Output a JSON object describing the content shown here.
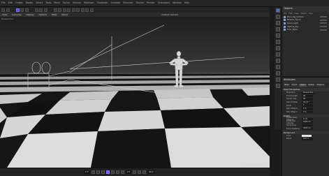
{
  "menubar": {
    "items": [
      "File",
      "Edit",
      "Create",
      "Modes",
      "Select",
      "Tools",
      "Mesh",
      "Spline",
      "Volume",
      "MoGraph",
      "Character",
      "Animate",
      "Simulate",
      "Tracker",
      "Render",
      "Extensions",
      "Window",
      "Help"
    ]
  },
  "viewport": {
    "tabs": [
      "View",
      "Cameras",
      "Display",
      "Options",
      "Filter",
      "Panel"
    ],
    "camera_label": "Default Camera",
    "label": "Perspective",
    "stats": "Grid Spacing : 100 cm"
  },
  "timeline": {
    "start_frame": "0 F",
    "end_frame": "90 F",
    "current_frame": "0 F"
  },
  "objects_panel": {
    "title": "Objects",
    "menu": [
      "File",
      "Edit",
      "View",
      "Object",
      "Tags"
    ],
    "objects": [
      "Bone_Rig_Camera",
      "Mixamo_Figure",
      "Scene_Light",
      "Capture_Rig",
      "Floor_Plane"
    ]
  },
  "attributes_panel": {
    "title": "Attributes",
    "tabs": [
      "Basic",
      "Coord.",
      "Object",
      "Details",
      "Physical"
    ],
    "section_object": "Object Properties",
    "fields": [
      {
        "label": "Projection",
        "value": "Perspective"
      },
      {
        "label": "Focal Length",
        "value": "36"
      },
      {
        "label": "Sensor Size",
        "value": "36"
      },
      {
        "label": "Field of View",
        "value": "53.13 °"
      },
      {
        "label": "Zoom",
        "value": "1"
      },
      {
        "label": "Film Offset X",
        "value": "0 %"
      },
      {
        "label": "Film Offset Y",
        "value": "0 %"
      }
    ],
    "section_details": "Details",
    "details": [
      {
        "label": "Enable Near Clipping",
        "value": "0 cm"
      },
      {
        "label": "Enable Far Clipping",
        "value": "1000 cm"
      },
      {
        "label": "Show Cone",
        "value": ""
      },
      {
        "label": "Focus Distance",
        "value": "2000 cm"
      }
    ],
    "section_background": "Background",
    "bg_color_label": "Color",
    "bg_blend_label": "Blend",
    "bg_blend_value": "100 %"
  }
}
